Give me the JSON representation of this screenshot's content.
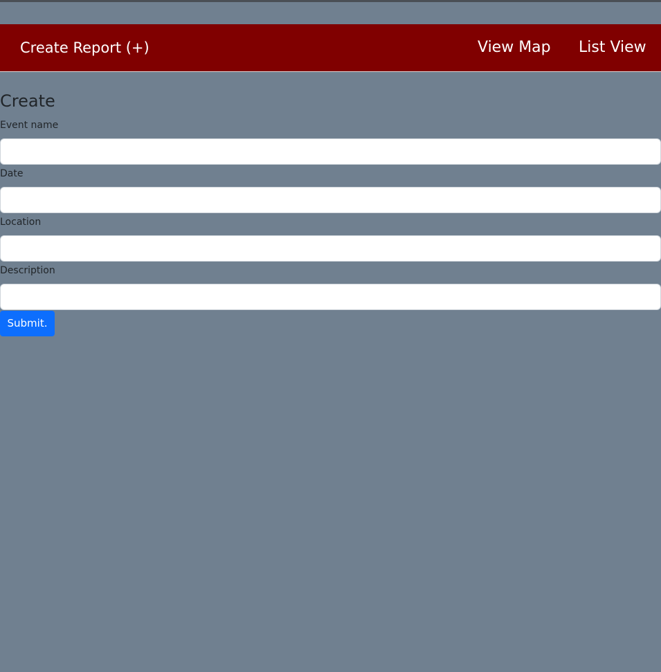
{
  "navbar": {
    "brand": "Create Report (+)",
    "links": [
      "View Map",
      "List View"
    ]
  },
  "form": {
    "title": "Create",
    "fields": [
      {
        "label": "Event name",
        "value": "",
        "placeholder": ""
      },
      {
        "label": "Date",
        "value": "",
        "placeholder": ""
      },
      {
        "label": "Location",
        "value": "",
        "placeholder": ""
      },
      {
        "label": "Description",
        "value": "",
        "placeholder": ""
      }
    ],
    "submit_label": "Submit."
  },
  "colors": {
    "background": "#708090",
    "navbar": "#800000",
    "button": "#0d6efd"
  }
}
